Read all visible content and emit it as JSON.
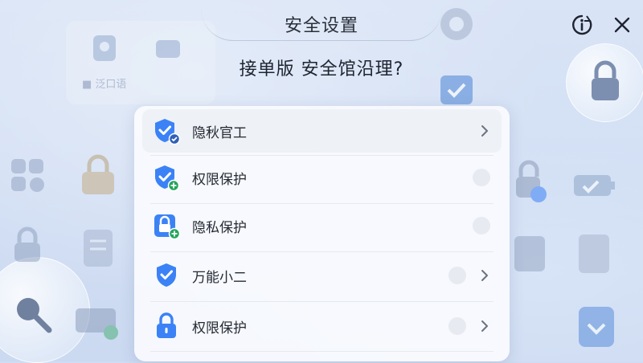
{
  "header": {
    "title": "安全设置",
    "subtitle": "接单版  安全馆沿理?"
  },
  "menu": {
    "items": [
      {
        "label": "隐秋官工",
        "icon": "shield-check-icon",
        "active": true
      },
      {
        "label": "权限保护",
        "icon": "shield-plus-icon",
        "active": false
      },
      {
        "label": "隐私保护",
        "icon": "lock-plus-icon",
        "active": false
      },
      {
        "label": "万能小二",
        "icon": "shield-check-icon",
        "active": false
      },
      {
        "label": "权限保护",
        "icon": "lock-icon",
        "active": false
      }
    ]
  },
  "background": {
    "deco_card_text": "■ 泛口语"
  },
  "colors": {
    "accent": "#3b82f6",
    "accent_dark": "#2563eb",
    "badge_green": "#22a55a",
    "text": "#252a33"
  }
}
